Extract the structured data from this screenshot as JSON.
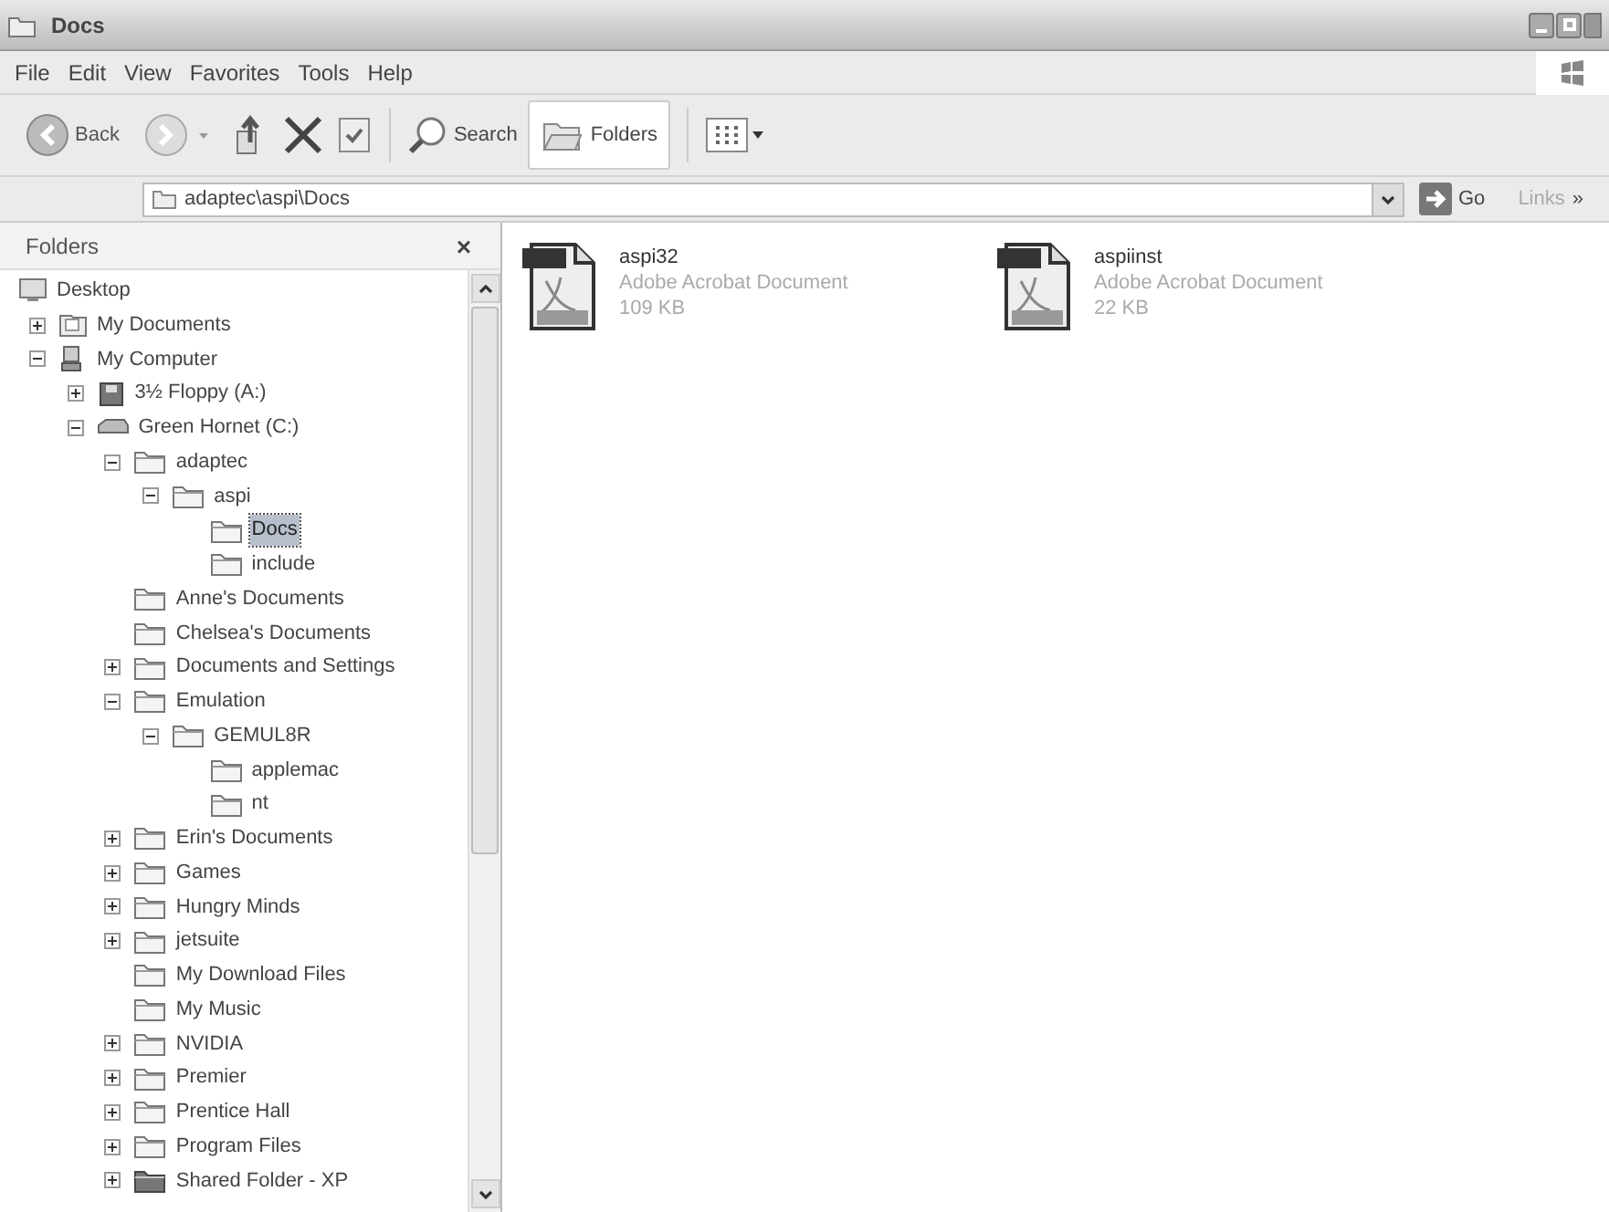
{
  "window": {
    "title": "Docs"
  },
  "menu": [
    "File",
    "Edit",
    "View",
    "Favorites",
    "Tools",
    "Help"
  ],
  "toolbar": {
    "back_label": "Back",
    "search_label": "Search",
    "folders_label": "Folders",
    "folders_selected": true
  },
  "address": {
    "value": "adaptec\\aspi\\Docs",
    "go_label": "Go",
    "links_label": "Links",
    "links_chevron": "»"
  },
  "folders_pane": {
    "title": "Folders",
    "close": "×",
    "tree": [
      {
        "label": "Desktop",
        "kind": "desktop",
        "selected": false,
        "children": [
          {
            "label": "My Documents",
            "kind": "documents",
            "expanded": false,
            "selected": false
          },
          {
            "label": "My Computer",
            "kind": "computer",
            "expanded": true,
            "selected": false,
            "children": [
              {
                "label": "3½ Floppy (A:)",
                "kind": "floppy",
                "expanded": false,
                "selected": false
              },
              {
                "label": "Green Hornet (C:)",
                "kind": "drive",
                "expanded": true,
                "selected": false,
                "children": [
                  {
                    "label": "adaptec",
                    "kind": "folder",
                    "expanded": true,
                    "selected": false,
                    "children": [
                      {
                        "label": "aspi",
                        "kind": "folder",
                        "expanded": true,
                        "selected": false,
                        "children": [
                          {
                            "label": "Docs",
                            "kind": "folder",
                            "selected": true
                          },
                          {
                            "label": "include",
                            "kind": "folder",
                            "selected": false
                          }
                        ]
                      }
                    ]
                  },
                  {
                    "label": "Anne's Documents",
                    "kind": "folder",
                    "selected": false
                  },
                  {
                    "label": "Chelsea's Documents",
                    "kind": "folder",
                    "selected": false
                  },
                  {
                    "label": "Documents and Settings",
                    "kind": "folder",
                    "expanded": false,
                    "selected": false
                  },
                  {
                    "label": "Emulation",
                    "kind": "folder",
                    "expanded": true,
                    "selected": false,
                    "children": [
                      {
                        "label": "GEMUL8R",
                        "kind": "folder",
                        "expanded": true,
                        "selected": false,
                        "children": [
                          {
                            "label": "applemac",
                            "kind": "folder",
                            "selected": false
                          },
                          {
                            "label": "nt",
                            "kind": "folder",
                            "selected": false
                          }
                        ]
                      }
                    ]
                  },
                  {
                    "label": "Erin's Documents",
                    "kind": "folder",
                    "expanded": false,
                    "selected": false
                  },
                  {
                    "label": "Games",
                    "kind": "folder",
                    "expanded": false,
                    "selected": false
                  },
                  {
                    "label": "Hungry Minds",
                    "kind": "folder",
                    "expanded": false,
                    "selected": false
                  },
                  {
                    "label": "jetsuite",
                    "kind": "folder",
                    "expanded": false,
                    "selected": false
                  },
                  {
                    "label": "My Download Files",
                    "kind": "folder",
                    "selected": false
                  },
                  {
                    "label": "My Music",
                    "kind": "folder",
                    "selected": false
                  },
                  {
                    "label": "NVIDIA",
                    "kind": "folder",
                    "expanded": false,
                    "selected": false
                  },
                  {
                    "label": "Premier",
                    "kind": "folder",
                    "expanded": false,
                    "selected": false
                  },
                  {
                    "label": "Prentice Hall",
                    "kind": "folder",
                    "expanded": false,
                    "selected": false
                  },
                  {
                    "label": "Program Files",
                    "kind": "folder",
                    "expanded": false,
                    "selected": false
                  },
                  {
                    "label": "Shared Folder - XP",
                    "kind": "shared",
                    "expanded": false,
                    "selected": false
                  }
                ]
              }
            ]
          }
        ]
      }
    ]
  },
  "files": [
    {
      "name": "aspi32",
      "type": "Adobe Acrobat Document",
      "size": "109 KB"
    },
    {
      "name": "aspiinst",
      "type": "Adobe Acrobat Document",
      "size": "22 KB"
    }
  ]
}
